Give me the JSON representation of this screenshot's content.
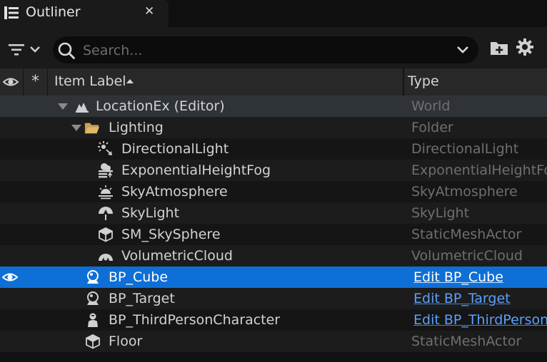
{
  "tab": {
    "title": "Outliner",
    "close": "✕",
    "icon": "outliner-icon"
  },
  "toolbar": {
    "filter_icon": "filter-icon",
    "search_placeholder": "Search...",
    "search_value": "",
    "add_folder_icon": "add-folder-icon",
    "settings_icon": "gear-icon"
  },
  "header": {
    "visibility_icon": "eye-icon",
    "pin": "*",
    "label": "Item Label",
    "type": "Type"
  },
  "rows": [
    {
      "label": "LocationEx (Editor)",
      "type": "World",
      "icon": "world-icon",
      "expanded": true
    },
    {
      "label": "Lighting",
      "type": "Folder",
      "icon": "folder-icon",
      "expanded": true
    },
    {
      "label": "DirectionalLight",
      "type": "DirectionalLight",
      "icon": "directional-light-icon"
    },
    {
      "label": "ExponentialHeightFog",
      "type": "ExponentialHeightFog",
      "icon": "fog-icon"
    },
    {
      "label": "SkyAtmosphere",
      "type": "SkyAtmosphere",
      "icon": "sky-atmosphere-icon"
    },
    {
      "label": "SkyLight",
      "type": "SkyLight",
      "icon": "sky-light-icon"
    },
    {
      "label": "SM_SkySphere",
      "type": "StaticMeshActor",
      "icon": "static-mesh-icon"
    },
    {
      "label": "VolumetricCloud",
      "type": "VolumetricCloud",
      "icon": "cloud-icon"
    },
    {
      "label": "BP_Cube",
      "type": "Edit BP_Cube",
      "icon": "blueprint-icon",
      "selected": true,
      "visible": true
    },
    {
      "label": "BP_Target",
      "type": "Edit BP_Target",
      "icon": "blueprint-icon"
    },
    {
      "label": "BP_ThirdPersonCharacter",
      "type": "Edit BP_ThirdPerson",
      "icon": "character-icon"
    },
    {
      "label": "Floor",
      "type": "StaticMeshActor",
      "icon": "static-mesh-icon"
    }
  ],
  "colors": {
    "selection": "#0e6fd6",
    "link": "#59a0ff",
    "world_row": "#2f3338"
  }
}
